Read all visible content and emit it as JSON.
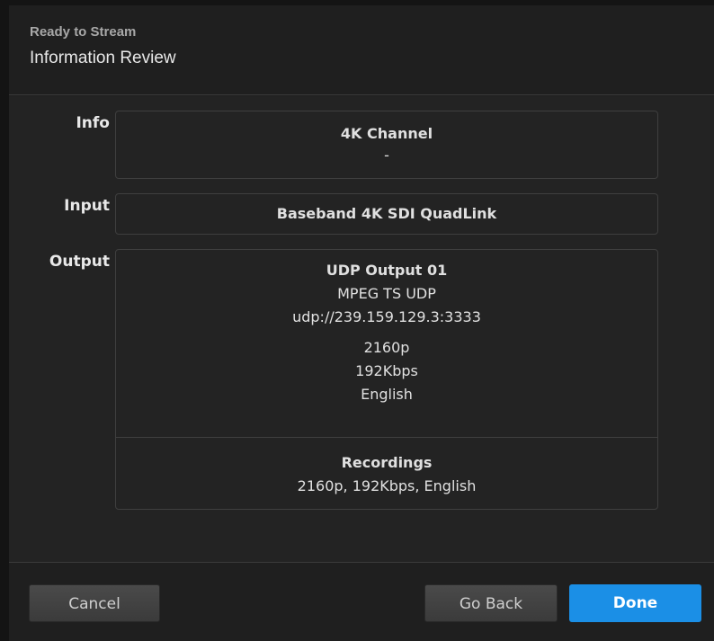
{
  "header": {
    "subtitle": "Ready to Stream",
    "title": "Information Review"
  },
  "info": {
    "label": "Info",
    "channel_name": "4K Channel",
    "description": "-"
  },
  "input": {
    "label": "Input",
    "name": "Baseband 4K SDI QuadLink"
  },
  "output": {
    "label": "Output",
    "name": "UDP Output 01",
    "type": "MPEG TS UDP",
    "url": "udp://239.159.129.3:3333",
    "resolution": "2160p",
    "bitrate": "192Kbps",
    "language": "English",
    "recordings_title": "Recordings",
    "recordings_details": "2160p, 192Kbps, English"
  },
  "footer": {
    "cancel_label": "Cancel",
    "go_back_label": "Go Back",
    "done_label": "Done"
  },
  "colors": {
    "accent": "#1b8fe6",
    "background": "#1f1f1f"
  }
}
